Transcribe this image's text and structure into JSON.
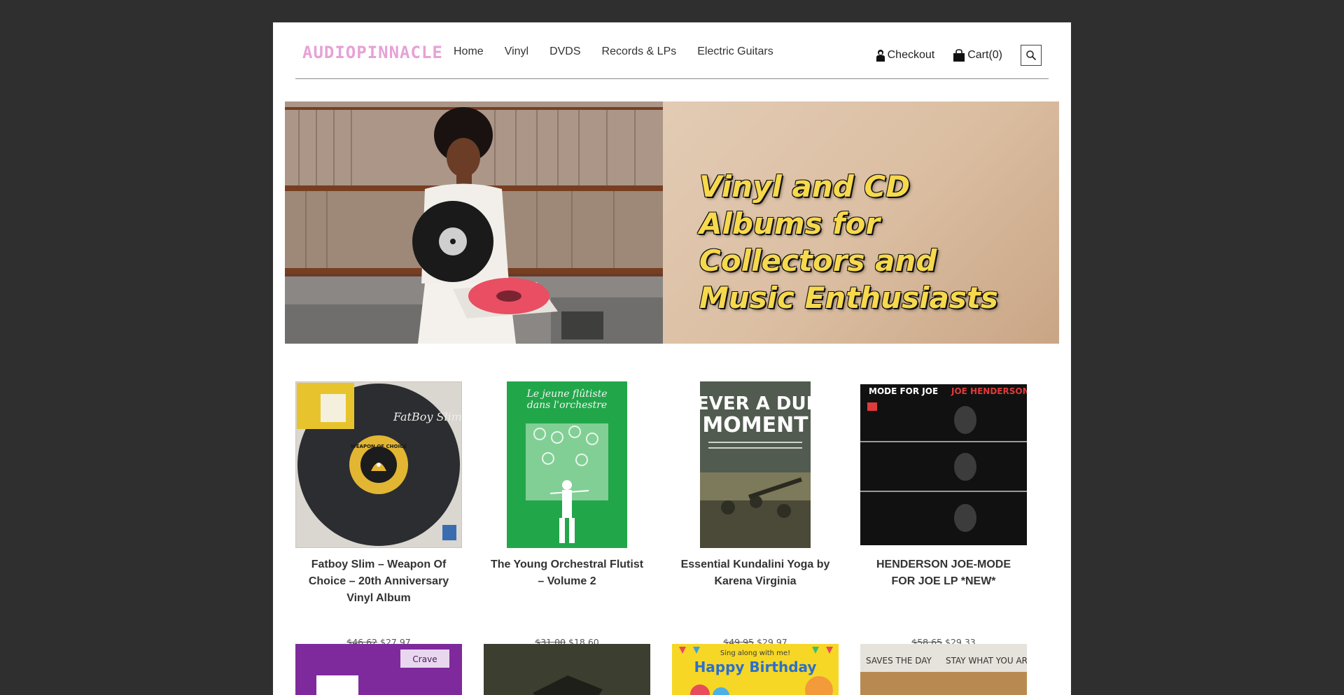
{
  "brand": {
    "logo_text": "AudioPinnacle"
  },
  "nav": [
    {
      "label": "Home"
    },
    {
      "label": "Vinyl"
    },
    {
      "label": "DVDS"
    },
    {
      "label": "Records & LPs"
    },
    {
      "label": "Electric Guitars"
    }
  ],
  "header": {
    "checkout_label": "Checkout",
    "cart_label": "Cart(0)"
  },
  "hero": {
    "title": "Vinyl and CD Albums for Collectors and Music Enthusiasts"
  },
  "products": [
    {
      "title": "Fatboy Slim – Weapon Of Choice – 20th Anniversary Vinyl Album",
      "old_price": "$46.62",
      "price": "$27.97",
      "cover_text": "WEAPON OF CHOICE"
    },
    {
      "title": "The Young Orchestral Flutist – Volume 2",
      "old_price": "$31.00",
      "price": "$18.60",
      "cover_text": "Le jeune flûtiste dans l'orchestre"
    },
    {
      "title": "Essential Kundalini Yoga by Karena Virginia",
      "old_price": "$49.95",
      "price": "$29.97",
      "cover_text": "NEVER A DULL MOMENT"
    },
    {
      "title": "HENDERSON JOE-MODE FOR JOE LP *NEW*",
      "old_price": "$58.65",
      "price": "$29.33",
      "cover_text": "MODE FOR JOE JOE HENDERSON"
    }
  ],
  "row2": [
    {
      "cover_text": "Crave"
    },
    {
      "cover_text": ""
    },
    {
      "cover_text": "Happy Birthday",
      "cover_sub": "Sing along with me!"
    },
    {
      "cover_text": "SAVES THE DAY",
      "cover_sub": "STAY WHAT YOU ARE"
    }
  ],
  "icons": {
    "checkout": "person-icon",
    "cart": "shopping-bag-icon",
    "search": "search-icon"
  }
}
